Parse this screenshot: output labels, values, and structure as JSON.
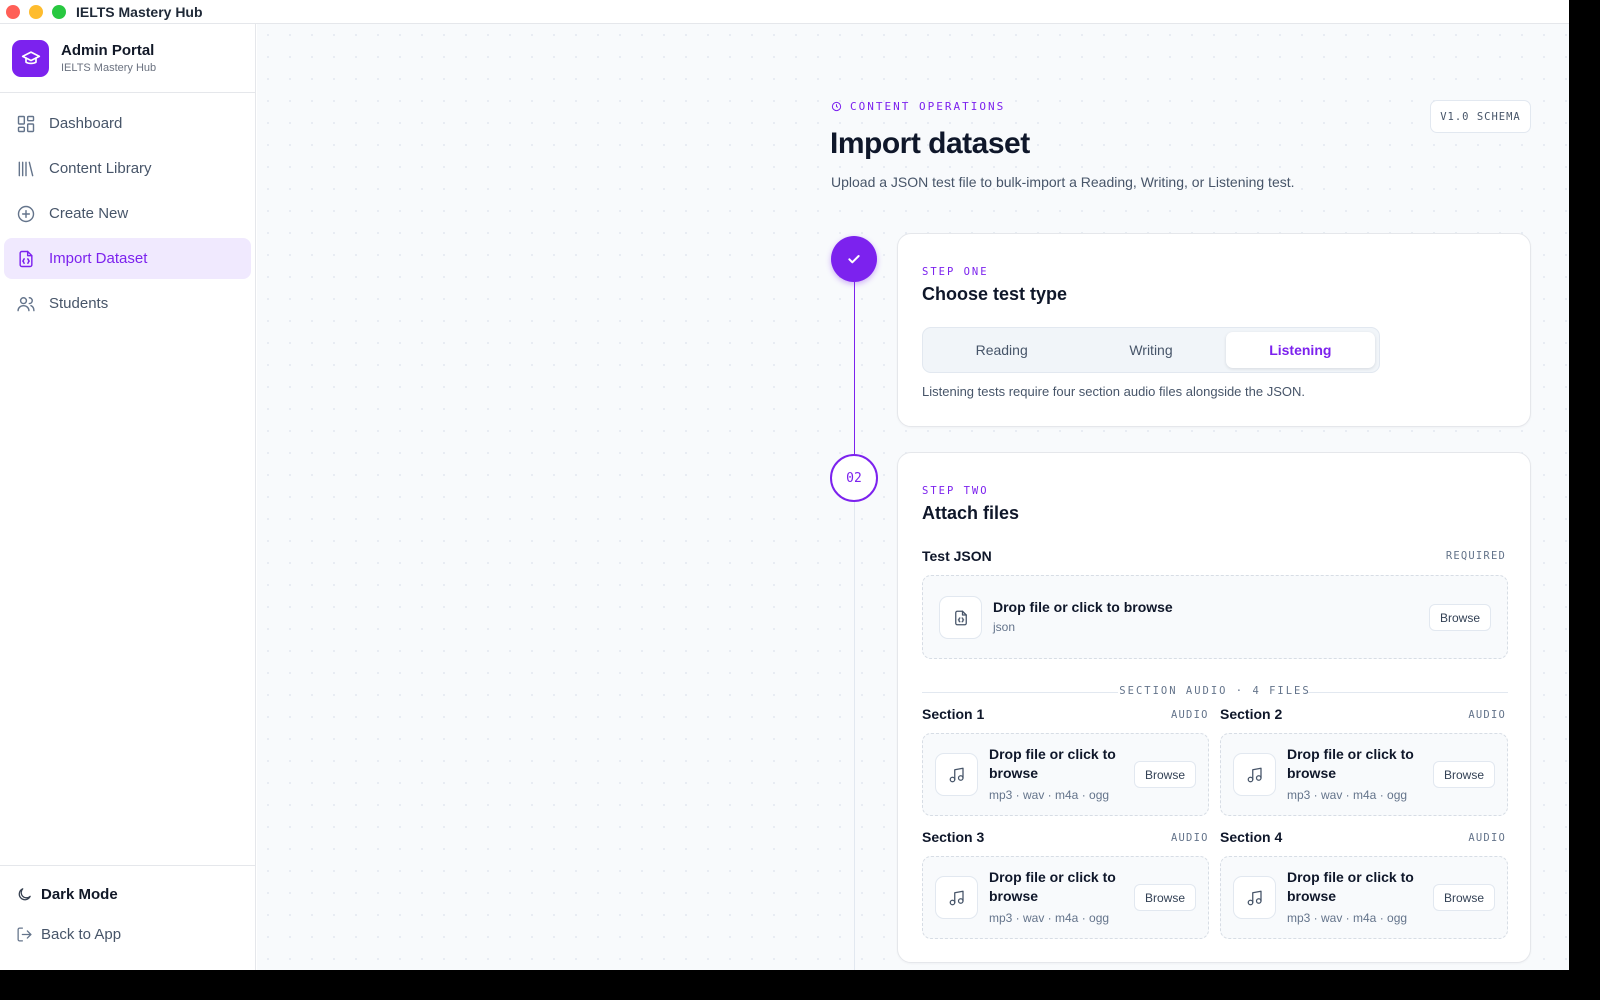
{
  "window": {
    "title": "IELTS Mastery Hub"
  },
  "colors": {
    "accent": "#7c22ee",
    "close": "#ff5f57",
    "minimize": "#febc2e",
    "maximize": "#28c840"
  },
  "sidebar": {
    "brand_title": "Admin Portal",
    "brand_subtitle": "IELTS Mastery Hub",
    "brand_icon": "graduation-cap-icon",
    "items": [
      {
        "label": "Dashboard",
        "icon": "dashboard-icon",
        "active": false
      },
      {
        "label": "Content Library",
        "icon": "library-icon",
        "active": false
      },
      {
        "label": "Create New",
        "icon": "plus-circle-icon",
        "active": false
      },
      {
        "label": "Import Dataset",
        "icon": "file-json-icon",
        "active": true
      },
      {
        "label": "Students",
        "icon": "users-icon",
        "active": false
      }
    ],
    "bottom": {
      "dark_mode_label": "Dark Mode",
      "back_label": "Back to App"
    }
  },
  "header": {
    "eyebrow": "CONTENT OPERATIONS",
    "title": "Import dataset",
    "description": "Upload a JSON test file to bulk-import a Reading, Writing, or Listening test.",
    "schema_badge": "V1.0 SCHEMA"
  },
  "step_one": {
    "label": "STEP ONE",
    "title": "Choose test type",
    "options": [
      "Reading",
      "Writing",
      "Listening"
    ],
    "selected": "Listening",
    "note": "Listening tests require four section audio files alongside the JSON.",
    "status": "complete"
  },
  "step_two": {
    "number": "02",
    "label": "STEP TWO",
    "title": "Attach files",
    "json_field": {
      "label": "Test JSON",
      "tag": "REQUIRED",
      "drop_text": "Drop file or click to browse",
      "formats": "json",
      "browse_label": "Browse"
    },
    "audio_divider": "SECTION AUDIO · 4 FILES",
    "audio_sections": [
      {
        "label": "Section 1",
        "tag": "AUDIO",
        "drop_text": "Drop file or click to browse",
        "formats": "mp3 · wav · m4a · ogg",
        "browse_label": "Browse"
      },
      {
        "label": "Section 2",
        "tag": "AUDIO",
        "drop_text": "Drop file or click to browse",
        "formats": "mp3 · wav · m4a · ogg",
        "browse_label": "Browse"
      },
      {
        "label": "Section 3",
        "tag": "AUDIO",
        "drop_text": "Drop file or click to browse",
        "formats": "mp3 · wav · m4a · ogg",
        "browse_label": "Browse"
      },
      {
        "label": "Section 4",
        "tag": "AUDIO",
        "drop_text": "Drop file or click to browse",
        "formats": "mp3 · wav · m4a · ogg",
        "browse_label": "Browse"
      }
    ]
  }
}
